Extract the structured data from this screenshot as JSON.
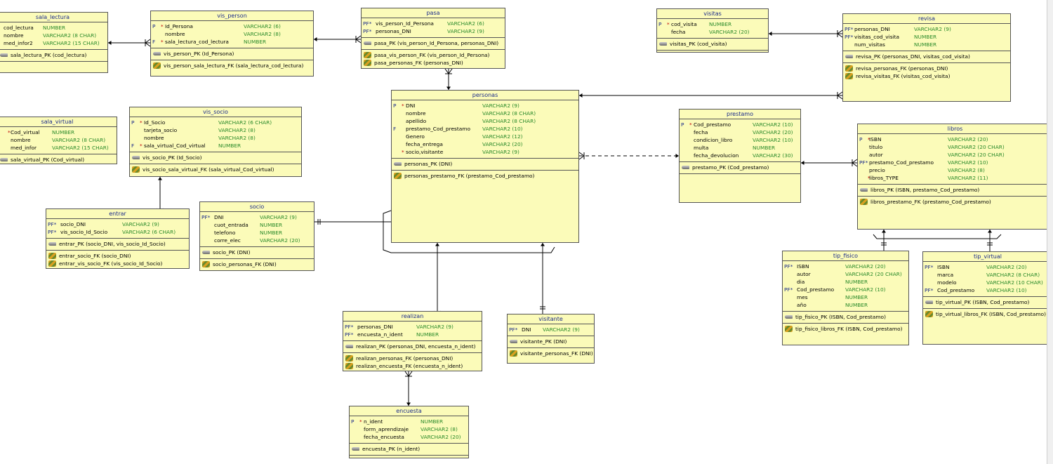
{
  "tables": {
    "sala_lectura": {
      "title": "sala_lectura",
      "columns": [
        {
          "flag": "",
          "star": "",
          "name": "cod_lectura",
          "type": "NUMBER"
        },
        {
          "flag": "",
          "star": "",
          "name": "nombre",
          "type": "VARCHAR2 (8 CHAR)"
        },
        {
          "flag": "",
          "star": "",
          "name": "med_infor2",
          "type": "VARCHAR2 (15 CHAR)"
        }
      ],
      "keys": [
        "sala_lectura_PK (cod_lectura)"
      ],
      "fks": []
    },
    "vis_person": {
      "title": "vis_person",
      "columns": [
        {
          "flag": "P",
          "star": "*",
          "name": "Id_Persona",
          "type": "VARCHAR2 (6)"
        },
        {
          "flag": "",
          "star": "",
          "name": "nombre",
          "type": "VARCHAR2 (8)"
        },
        {
          "flag": "F",
          "star": "*",
          "name": "sala_lectura_cod_lectura",
          "type": "NUMBER"
        }
      ],
      "keys": [
        "vis_person_PK (Id_Persona)"
      ],
      "fks": [
        "vis_person_sala_lectura_FK (sala_lectura_cod_lectura)"
      ]
    },
    "pasa": {
      "title": "pasa",
      "columns": [
        {
          "flag": "PF*",
          "star": "",
          "name": "vis_person_Id_Persona",
          "type": "VARCHAR2 (6)"
        },
        {
          "flag": "PF*",
          "star": "",
          "name": "personas_DNI",
          "type": "VARCHAR2 (9)"
        }
      ],
      "keys": [
        "pasa_PK (vis_person_Id_Persona, personas_DNI)"
      ],
      "fks": [
        "pasa_vis_person_FK (vis_person_Id_Persona)",
        "pasa_personas_FK (personas_DNI)"
      ]
    },
    "visitas": {
      "title": "visitas",
      "columns": [
        {
          "flag": "P",
          "star": "*",
          "name": "cod_visita",
          "type": "NUMBER"
        },
        {
          "flag": "",
          "star": "",
          "name": "fecha",
          "type": "VARCHAR2 (20)"
        }
      ],
      "keys": [
        "visitas_PK (cod_visita)"
      ],
      "fks": []
    },
    "revisa": {
      "title": "revisa",
      "columns": [
        {
          "flag": "PF*",
          "star": "",
          "name": "personas_DNI",
          "type": "VARCHAR2 (9)"
        },
        {
          "flag": "PF*",
          "star": "",
          "name": "visitas_cod_visita",
          "type": "NUMBER"
        },
        {
          "flag": "",
          "star": "",
          "name": "num_visitas",
          "type": "NUMBER"
        }
      ],
      "keys": [
        "revisa_PK (personas_DNI, visitas_cod_visita)"
      ],
      "fks": [
        "revisa_personas_FK (personas_DNI)",
        "revisa_visitas_FK (visitas_cod_visita)"
      ]
    },
    "personas": {
      "title": "personas",
      "columns": [
        {
          "flag": "P",
          "star": "*",
          "name": "DNI",
          "type": "VARCHAR2 (9)"
        },
        {
          "flag": "",
          "star": "",
          "name": "nombre",
          "type": "VARCHAR2 (8 CHAR)"
        },
        {
          "flag": "",
          "star": "",
          "name": "apellido",
          "type": "VARCHAR2 (8 CHAR)"
        },
        {
          "flag": "F",
          "star": "",
          "name": "prestamo_Cod_prestamo",
          "type": "VARCHAR2 (10)"
        },
        {
          "flag": "",
          "star": "",
          "name": "Genero",
          "type": "VARCHAR2 (12)"
        },
        {
          "flag": "",
          "star": "",
          "name": "fecha_entrega",
          "type": "VARCHAR2 (20)"
        },
        {
          "flag": "",
          "star": "*",
          "name": "socio,visitante",
          "type": "VARCHAR2 (9)"
        }
      ],
      "keys": [
        "personas_PK (DNI)"
      ],
      "fks": [
        "personas_prestamo_FK (prestamo_Cod_prestamo)"
      ]
    },
    "prestamo": {
      "title": "prestamo",
      "columns": [
        {
          "flag": "P",
          "star": "*",
          "name": "Cod_prestamo",
          "type": "VARCHAR2 (10)"
        },
        {
          "flag": "",
          "star": "",
          "name": "fecha",
          "type": "VARCHAR2 (20)"
        },
        {
          "flag": "",
          "star": "",
          "name": "condicion_libro",
          "type": "VARCHAR2 (10)"
        },
        {
          "flag": "",
          "star": "",
          "name": "multa",
          "type": "NUMBER"
        },
        {
          "flag": "",
          "star": "",
          "name": "fecha_devolucion",
          "type": "VARCHAR2 (30)"
        }
      ],
      "keys": [
        "prestamo_PK (Cod_prestamo)"
      ],
      "fks": []
    },
    "libros": {
      "title": "libros",
      "columns": [
        {
          "flag": "P",
          "star": "*",
          "name": "ISBN",
          "type": "VARCHAR2 (20)"
        },
        {
          "flag": "",
          "star": "",
          "name": "titulo",
          "type": "VARCHAR2 (20 CHAR)"
        },
        {
          "flag": "",
          "star": "",
          "name": "autor",
          "type": "VARCHAR2 (20 CHAR)"
        },
        {
          "flag": "PF*",
          "star": "",
          "name": "prestamo_Cod_prestamo",
          "type": "VARCHAR2 (10)"
        },
        {
          "flag": "",
          "star": "",
          "name": "precio",
          "type": "VARCHAR2 (8)"
        },
        {
          "flag": "",
          "star": "*",
          "name": "libros_TYPE",
          "type": "VARCHAR2 (11)"
        }
      ],
      "keys": [
        "libros_PK (ISBN, prestamo_Cod_prestamo)"
      ],
      "fks": [
        "libros_prestamo_FK (prestamo_Cod_prestamo)"
      ]
    },
    "sala_virtual": {
      "title": "sala_virtual",
      "columns": [
        {
          "flag": "",
          "star": "*",
          "name": "Cod_virtual",
          "type": "NUMBER"
        },
        {
          "flag": "",
          "star": "",
          "name": "nombre",
          "type": "VARCHAR2 (8 CHAR)"
        },
        {
          "flag": "",
          "star": "",
          "name": "med_infor",
          "type": "VARCHAR2 (15 CHAR)"
        }
      ],
      "keys": [
        "sala_virtual_PK (Cod_virtual)"
      ],
      "fks": []
    },
    "vis_socio": {
      "title": "vis_socio",
      "columns": [
        {
          "flag": "P",
          "star": "*",
          "name": "Id_Socio",
          "type": "VARCHAR2 (6 CHAR)"
        },
        {
          "flag": "",
          "star": "",
          "name": "tarjeta_socio",
          "type": "VARCHAR2 (8)"
        },
        {
          "flag": "",
          "star": "",
          "name": "nombre",
          "type": "VARCHAR2 (8)"
        },
        {
          "flag": "F",
          "star": "*",
          "name": "sala_virtual_Cod_virtual",
          "type": "NUMBER"
        }
      ],
      "keys": [
        "vis_socio_PK (Id_Socio)"
      ],
      "fks": [
        "vis_socio_sala_virtual_FK (sala_virtual_Cod_virtual)"
      ]
    },
    "entrar": {
      "title": "entrar",
      "columns": [
        {
          "flag": "PF*",
          "star": "",
          "name": "socio_DNI",
          "type": "VARCHAR2 (9)"
        },
        {
          "flag": "PF*",
          "star": "",
          "name": "vis_socio_Id_Socio",
          "type": "VARCHAR2 (6 CHAR)"
        }
      ],
      "keys": [
        "entrar_PK (socio_DNI, vis_socio_Id_Socio)"
      ],
      "fks": [
        "entrar_socio_FK (socio_DNI)",
        "entrar_vis_socio_FK (vis_socio_Id_Socio)"
      ]
    },
    "socio": {
      "title": "socio",
      "columns": [
        {
          "flag": "PF*",
          "star": "",
          "name": "DNI",
          "type": "VARCHAR2 (9)"
        },
        {
          "flag": "",
          "star": "",
          "name": "cuot_entrada",
          "type": "NUMBER"
        },
        {
          "flag": "",
          "star": "",
          "name": "telefono",
          "type": "NUMBER"
        },
        {
          "flag": "",
          "star": "",
          "name": "corre_elec",
          "type": "VARCHAR2 (20)"
        }
      ],
      "keys": [
        "socio_PK (DNI)"
      ],
      "fks": [
        "socio_personas_FK (DNI)"
      ]
    },
    "realizan": {
      "title": "realizan",
      "columns": [
        {
          "flag": "PF*",
          "star": "",
          "name": "personas_DNI",
          "type": "VARCHAR2 (9)"
        },
        {
          "flag": "PF*",
          "star": "",
          "name": "encuesta_n_ident",
          "type": "NUMBER"
        }
      ],
      "keys": [
        "realizan_PK (personas_DNI, encuesta_n_ident)"
      ],
      "fks": [
        "realizan_personas_FK (personas_DNI)",
        "realizan_encuesta_FK (encuesta_n_ident)"
      ]
    },
    "visitante": {
      "title": "visitante",
      "columns": [
        {
          "flag": "PF*",
          "star": "",
          "name": "DNI",
          "type": "VARCHAR2 (9)"
        }
      ],
      "keys": [
        "visitante_PK (DNI)"
      ],
      "fks": [
        "visitante_personas_FK (DNI)"
      ]
    },
    "encuesta": {
      "title": "encuesta",
      "columns": [
        {
          "flag": "P",
          "star": "*",
          "name": "n_ident",
          "type": "NUMBER"
        },
        {
          "flag": "",
          "star": "",
          "name": "form_aprendizaje",
          "type": "VARCHAR2 (8)"
        },
        {
          "flag": "",
          "star": "",
          "name": "fecha_encuesta",
          "type": "VARCHAR2 (20)"
        }
      ],
      "keys": [
        "encuesta_PK (n_ident)"
      ],
      "fks": []
    },
    "tip_fisico": {
      "title": "tip_fisico",
      "columns": [
        {
          "flag": "PF*",
          "star": "",
          "name": "ISBN",
          "type": "VARCHAR2 (20)"
        },
        {
          "flag": "",
          "star": "",
          "name": "autor",
          "type": "VARCHAR2 (20 CHAR)"
        },
        {
          "flag": "",
          "star": "",
          "name": "dia",
          "type": "NUMBER"
        },
        {
          "flag": "PF*",
          "star": "",
          "name": "Cod_prestamo",
          "type": "VARCHAR2 (10)"
        },
        {
          "flag": "",
          "star": "",
          "name": "mes",
          "type": "NUMBER"
        },
        {
          "flag": "",
          "star": "",
          "name": "año",
          "type": "NUMBER"
        }
      ],
      "keys": [
        "tip_fisico_PK (ISBN, Cod_prestamo)"
      ],
      "fks": [
        "tip_fisico_libros_FK (ISBN, Cod_prestamo)"
      ]
    },
    "tip_virtual": {
      "title": "tip_virtual",
      "columns": [
        {
          "flag": "PF*",
          "star": "",
          "name": "ISBN",
          "type": "VARCHAR2 (20)"
        },
        {
          "flag": "",
          "star": "",
          "name": "marca",
          "type": "VARCHAR2 (8 CHAR)"
        },
        {
          "flag": "",
          "star": "",
          "name": "modelo",
          "type": "VARCHAR2 (10 CHAR)"
        },
        {
          "flag": "PF*",
          "star": "",
          "name": "Cod_prestamo",
          "type": "VARCHAR2 (10)"
        }
      ],
      "keys": [
        "tip_virtual_PK (ISBN, Cod_prestamo)"
      ],
      "fks": [
        "tip_virtual_libros_FK (ISBN, Cod_prestamo)"
      ]
    }
  },
  "relationships": [
    {
      "from": "vis_person",
      "to": "sala_lectura",
      "style": "solid"
    },
    {
      "from": "pasa",
      "to": "vis_person",
      "style": "solid"
    },
    {
      "from": "pasa",
      "to": "personas",
      "style": "solid"
    },
    {
      "from": "revisa",
      "to": "visitas",
      "style": "solid"
    },
    {
      "from": "revisa",
      "to": "personas",
      "style": "solid"
    },
    {
      "from": "personas",
      "to": "prestamo",
      "style": "dashed"
    },
    {
      "from": "libros",
      "to": "prestamo",
      "style": "solid"
    },
    {
      "from": "vis_socio",
      "to": "entrar",
      "style": "solid"
    },
    {
      "from": "socio",
      "to": "personas",
      "style": "solid"
    },
    {
      "from": "realizan",
      "to": "personas",
      "style": "solid"
    },
    {
      "from": "visitante",
      "to": "personas",
      "style": "solid"
    },
    {
      "from": "realizan",
      "to": "encuesta",
      "style": "solid"
    },
    {
      "from": "tip_fisico",
      "to": "libros",
      "style": "solid"
    },
    {
      "from": "tip_virtual",
      "to": "libros",
      "style": "solid"
    }
  ],
  "colors": {
    "table_fill": "#fbfbb9",
    "title_text": "#1a2a8a",
    "type_text": "#2a8a2a",
    "star": "#c00000",
    "line": "#000000"
  }
}
